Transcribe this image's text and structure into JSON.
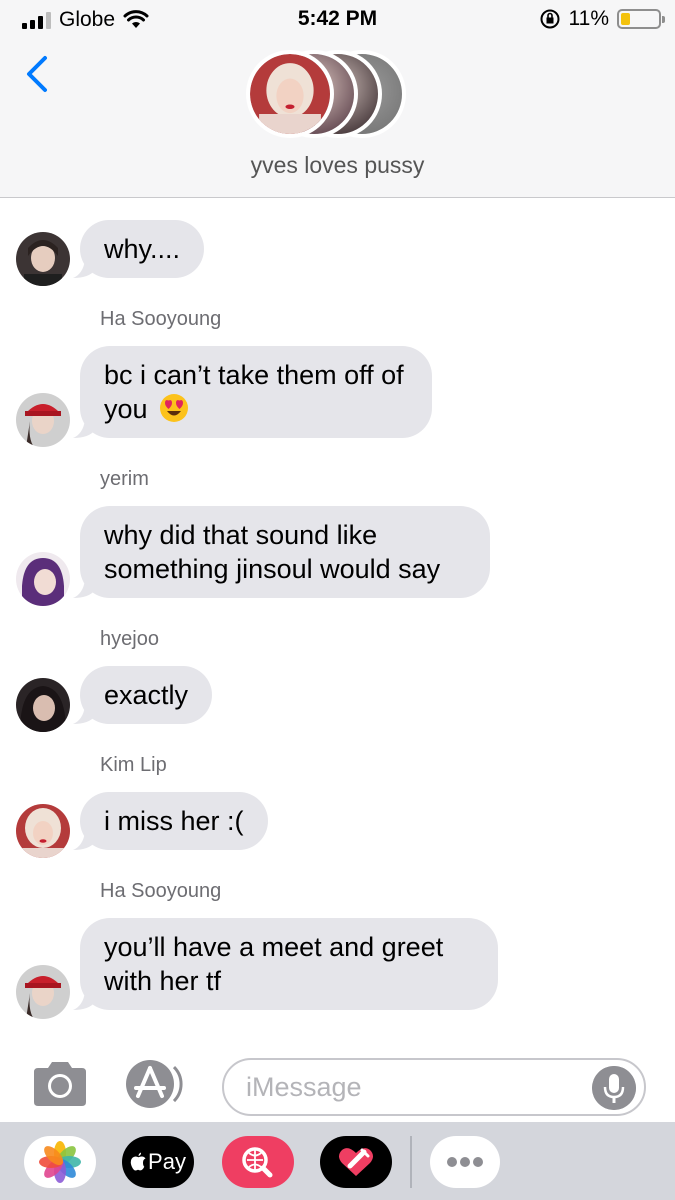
{
  "status_bar": {
    "carrier": "Globe",
    "time": "5:42 PM",
    "battery_percent": "11%",
    "battery_level": 0.11,
    "icons": [
      "signal-icon",
      "wifi-icon",
      "orientation-lock-icon",
      "battery-icon"
    ]
  },
  "header": {
    "group_name": "yves loves pussy",
    "back_icon": "chevron-left-icon"
  },
  "messages": [
    {
      "sender": "",
      "text": "why...."
    },
    {
      "sender": "Ha Sooyoung",
      "text": "bc i can’t take them off of you",
      "emoji": "heart-eyes-emoji"
    },
    {
      "sender": "yerim",
      "text": "why did that sound like something jinsoul would say"
    },
    {
      "sender": "hyejoo",
      "text": "exactly"
    },
    {
      "sender": "Kim Lip",
      "text": "i miss her :("
    },
    {
      "sender": "Ha Sooyoung",
      "text": "you’ll have a meet and greet with her tf"
    }
  ],
  "compose": {
    "placeholder": "iMessage",
    "icons": [
      "camera-icon",
      "app-store-icon",
      "microphone-icon"
    ]
  },
  "app_drawer": {
    "apps": [
      "photos-icon",
      "apple-pay-icon",
      "web-search-icon",
      "digital-touch-icon",
      "more-icon"
    ],
    "apple_pay_label": "Pay"
  },
  "colors": {
    "bubble": "#e5e5ea",
    "accent": "#007aff",
    "battery": "#f4c20d"
  }
}
